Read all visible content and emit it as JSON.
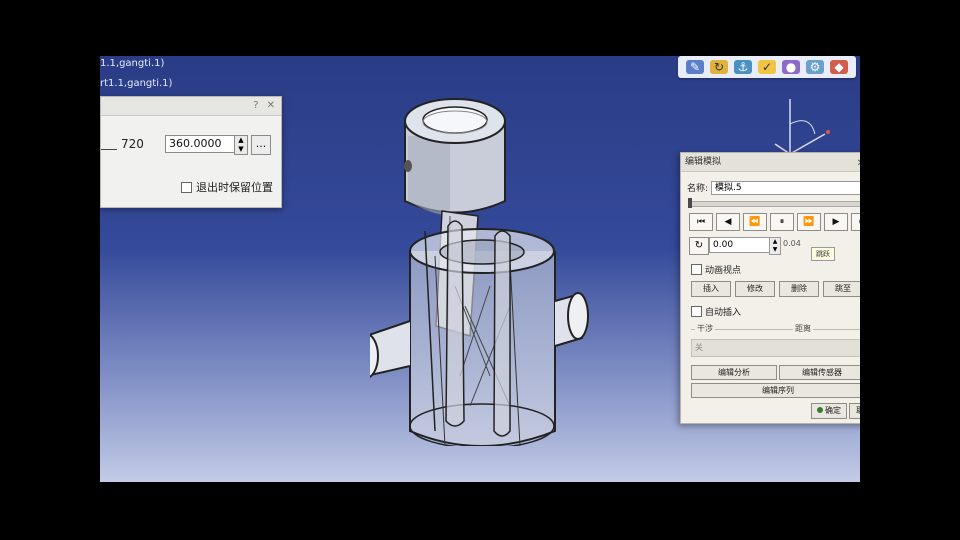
{
  "tree": {
    "line1": "1.1,gangti.1)",
    "line2": "rt1.1,gangti.1)"
  },
  "toolbar": {
    "icons": [
      "sketch-icon",
      "rotate-icon",
      "anchor-icon",
      "check-icon",
      "sphere-icon",
      "gear-icon",
      "palette-icon"
    ]
  },
  "left_dialog": {
    "value_label": "720",
    "value_input": "360.0000",
    "more_button": "...",
    "keep_position_checkbox": "退出时保留位置",
    "close_glyph": "✕",
    "help_glyph": "?"
  },
  "right_dialog": {
    "title": "编辑模拟",
    "close_glyph": "✕",
    "name_label": "名称:",
    "name_value": "模拟.5",
    "controls": [
      "⏮",
      "◀",
      "⏪",
      "⏸",
      "⏩",
      "▶",
      "⏭"
    ],
    "step_icon": "↻",
    "step_value": "0.00",
    "step_unit": "0.04",
    "tooltip": "跳跃",
    "animate_viewpoint_checkbox": "动画视点",
    "buttons": [
      "插入",
      "修改",
      "删除",
      "跳至"
    ],
    "auto_insert_checkbox": "自动插入",
    "interference_label": "干涉",
    "distance_label": "距离",
    "disabled_box": "关",
    "edit_analysis_button": "编辑分析",
    "edit_sensor_button": "编辑传感器",
    "edit_sequence_button": "编辑序列",
    "ok_button": "确定",
    "cancel_button": "取"
  },
  "colors": {
    "background_top": "#2a3c86",
    "background_bottom": "#c3cbe6",
    "dialog_bg": "#f1f1ef",
    "part_fill": "#c9cdd9"
  }
}
